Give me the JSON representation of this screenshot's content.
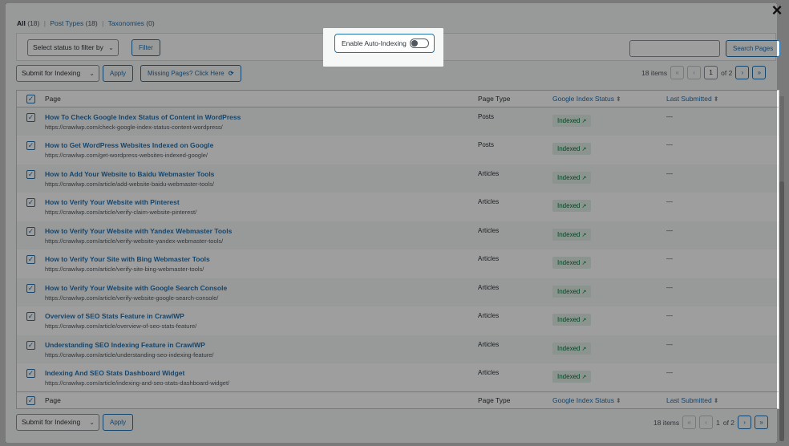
{
  "close_icon": "×",
  "filters": {
    "all_label": "All",
    "all_count": "(18)",
    "post_types_label": "Post Types",
    "post_types_count": "(18)",
    "taxonomies_label": "Taxonomies",
    "taxonomies_count": "(0)"
  },
  "toolbar": {
    "status_select": "Select status to filter by",
    "filter_button": "Filter",
    "auto_indexing_label": "Enable Auto-Indexing",
    "auto_indexing_enabled": false,
    "search_value": "",
    "search_button": "Search Pages"
  },
  "bulk_top": {
    "action_select": "Submit for Indexing",
    "apply_button": "Apply",
    "missing_pages_button": "Missing Pages? Click Here"
  },
  "pagination_top": {
    "items": "18 items",
    "first": "«",
    "prev": "‹",
    "current_page": "1",
    "of_total": "of 2",
    "next": "›",
    "last": "»"
  },
  "table": {
    "columns": [
      "Page",
      "Page Type",
      "Google Index Status",
      "Last Submitted"
    ],
    "sort_icon": "⬍",
    "rows": [
      {
        "title": "How To Check Google Index Status of Content in WordPress",
        "url": "https://crawlwp.com/check-google-index-status-content-wordpress/",
        "type": "Posts",
        "status": "Indexed",
        "last": "—"
      },
      {
        "title": "How to Get WordPress Websites Indexed on Google",
        "url": "https://crawlwp.com/get-wordpress-websites-indexed-google/",
        "type": "Posts",
        "status": "Indexed",
        "last": "—"
      },
      {
        "title": "How to Add Your Website to Baidu Webmaster Tools",
        "url": "https://crawlwp.com/article/add-website-baidu-webmaster-tools/",
        "type": "Articles",
        "status": "Indexed",
        "last": "—"
      },
      {
        "title": "How to Verify Your Website with Pinterest",
        "url": "https://crawlwp.com/article/verify-claim-website-pinterest/",
        "type": "Articles",
        "status": "Indexed",
        "last": "—"
      },
      {
        "title": "How to Verify Your Website with Yandex Webmaster Tools",
        "url": "https://crawlwp.com/article/verify-website-yandex-webmaster-tools/",
        "type": "Articles",
        "status": "Indexed",
        "last": "—"
      },
      {
        "title": "How to Verify Your Site with Bing Webmaster Tools",
        "url": "https://crawlwp.com/article/verify-site-bing-webmaster-tools/",
        "type": "Articles",
        "status": "Indexed",
        "last": "—"
      },
      {
        "title": "How to Verify Your Website with Google Search Console",
        "url": "https://crawlwp.com/article/verify-website-google-search-console/",
        "type": "Articles",
        "status": "Indexed",
        "last": "—"
      },
      {
        "title": "Overview of SEO Stats Feature in CrawlWP",
        "url": "https://crawlwp.com/article/overview-of-seo-stats-feature/",
        "type": "Articles",
        "status": "Indexed",
        "last": "—"
      },
      {
        "title": "Understanding SEO Indexing Feature in CrawlWP",
        "url": "https://crawlwp.com/article/understanding-seo-indexing-feature/",
        "type": "Articles",
        "status": "Indexed",
        "last": "—"
      },
      {
        "title": "Indexing And SEO Stats Dashboard Widget",
        "url": "https://crawlwp.com/article/indexing-and-seo-stats-dashboard-widget/",
        "type": "Articles",
        "status": "Indexed",
        "last": "—"
      }
    ]
  },
  "bulk_bottom": {
    "action_select": "Submit for Indexing",
    "apply_button": "Apply"
  },
  "pagination_bottom": {
    "items": "18 items",
    "first": "«",
    "prev": "‹",
    "current_page": "1",
    "of_total": "of 2",
    "next": "›",
    "last": "»"
  },
  "colors": {
    "accent": "#2271b1",
    "indexed_bg": "#e0efe6",
    "indexed_text": "#00733b",
    "overlay": "#7a7a7a"
  }
}
